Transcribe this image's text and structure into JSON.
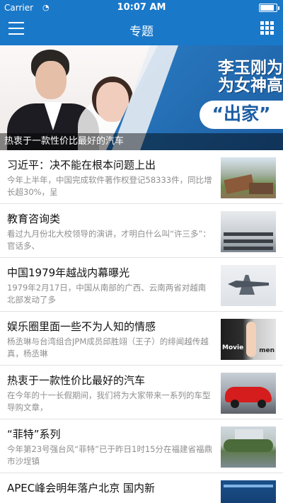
{
  "status_bar": {
    "carrier": "Carrier",
    "time": "10:07 AM",
    "battery_level": 0.85
  },
  "nav": {
    "title": "专题"
  },
  "banner": {
    "headline_line1": "李玉刚为",
    "headline_line2": "为女神高",
    "headline_tag": "“出家”",
    "caption": "热衷于一款性价比最好的汽车"
  },
  "articles": [
    {
      "title": "习近平：决不能在根本问题上出",
      "desc": "今年上半年，中国完成软件著作权登记58333件，同比增长超30%，呈",
      "thumb": "disaster-photo"
    },
    {
      "title": "教育咨询类",
      "desc": "看过九月份北大校领导的演讲，才明白什么叫“许三多”：官话多、",
      "thumb": "classroom-photo"
    },
    {
      "title": "中国1979年越战内幕曝光",
      "desc": "1979年2月17日，中国从南部的广西、云南两省对越南北部发动了多",
      "thumb": "fighter-jet-photo"
    },
    {
      "title": "娱乐圈里面一些不为人知的情感",
      "desc": "杨丞琳与台湾组合JPM成员邱胜翊（王子）的绯闻越传越真，杨丞琳",
      "thumb": "magazine-cover-photo",
      "thumb_text_left": "Movie",
      "thumb_text_right": "men"
    },
    {
      "title": "热衷于一款性价比最好的汽车",
      "desc": "在今年的十一长假期间，我们将为大家带来一系列的车型导购文章，",
      "thumb": "red-sports-car-photo"
    },
    {
      "title": "“菲特”系列",
      "desc": "今年第23号强台风“菲特”已于昨日1时15分在福建省福鼎市沙埕镇",
      "thumb": "flood-photo"
    },
    {
      "title": "APEC峰会明年落户北京 国内新",
      "desc": "",
      "thumb": "conference-photo"
    }
  ],
  "colors": {
    "nav_bar": "#1a78c9",
    "title_text": "#111111",
    "desc_text": "#8e8e8e"
  }
}
